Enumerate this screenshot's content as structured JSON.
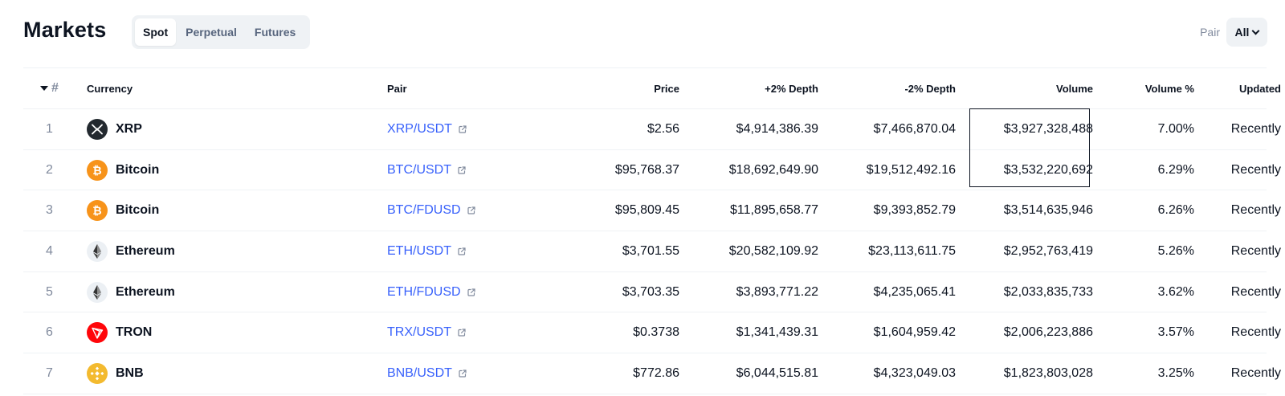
{
  "header": {
    "title": "Markets",
    "tabs": [
      {
        "label": "Spot",
        "active": true
      },
      {
        "label": "Perpetual",
        "active": false
      },
      {
        "label": "Futures",
        "active": false
      }
    ],
    "pair_filter": {
      "label": "Pair",
      "value": "All"
    }
  },
  "table": {
    "columns": {
      "rank": "#",
      "currency": "Currency",
      "pair": "Pair",
      "price": "Price",
      "depth_plus": "+2% Depth",
      "depth_minus": "-2% Depth",
      "volume": "Volume",
      "volume_pct": "Volume %",
      "updated": "Updated"
    },
    "rows": [
      {
        "rank": "1",
        "currency": "XRP",
        "icon": "xrp-icon",
        "pair": "XRP/USDT",
        "price": "$2.56",
        "depth_plus": "$4,914,386.39",
        "depth_minus": "$7,466,870.04",
        "volume": "$3,927,328,488",
        "volume_pct": "7.00%",
        "updated": "Recently"
      },
      {
        "rank": "2",
        "currency": "Bitcoin",
        "icon": "bitcoin-icon",
        "pair": "BTC/USDT",
        "price": "$95,768.37",
        "depth_plus": "$18,692,649.90",
        "depth_minus": "$19,512,492.16",
        "volume": "$3,532,220,692",
        "volume_pct": "6.29%",
        "updated": "Recently"
      },
      {
        "rank": "3",
        "currency": "Bitcoin",
        "icon": "bitcoin-icon",
        "pair": "BTC/FDUSD",
        "price": "$95,809.45",
        "depth_plus": "$11,895,658.77",
        "depth_minus": "$9,393,852.79",
        "volume": "$3,514,635,946",
        "volume_pct": "6.26%",
        "updated": "Recently"
      },
      {
        "rank": "4",
        "currency": "Ethereum",
        "icon": "ethereum-icon",
        "pair": "ETH/USDT",
        "price": "$3,701.55",
        "depth_plus": "$20,582,109.92",
        "depth_minus": "$23,113,611.75",
        "volume": "$2,952,763,419",
        "volume_pct": "5.26%",
        "updated": "Recently"
      },
      {
        "rank": "5",
        "currency": "Ethereum",
        "icon": "ethereum-icon",
        "pair": "ETH/FDUSD",
        "price": "$3,703.35",
        "depth_plus": "$3,893,771.22",
        "depth_minus": "$4,235,065.41",
        "volume": "$2,033,835,733",
        "volume_pct": "3.62%",
        "updated": "Recently"
      },
      {
        "rank": "6",
        "currency": "TRON",
        "icon": "tron-icon",
        "pair": "TRX/USDT",
        "price": "$0.3738",
        "depth_plus": "$1,341,439.31",
        "depth_minus": "$1,604,959.42",
        "volume": "$2,006,223,886",
        "volume_pct": "3.57%",
        "updated": "Recently"
      },
      {
        "rank": "7",
        "currency": "BNB",
        "icon": "bnb-icon",
        "pair": "BNB/USDT",
        "price": "$772.86",
        "depth_plus": "$6,044,515.81",
        "depth_minus": "$4,323,049.03",
        "volume": "$1,823,803,028",
        "volume_pct": "3.25%",
        "updated": "Recently"
      }
    ]
  },
  "colors": {
    "link": "#3861fb",
    "muted": "#808a9d",
    "text": "#0d1421",
    "bitcoin": "#f7931a",
    "tron": "#ff060a",
    "bnb": "#f3ba2f",
    "xrp": "#23292f",
    "ethereum_bg": "#ecf0f4"
  }
}
